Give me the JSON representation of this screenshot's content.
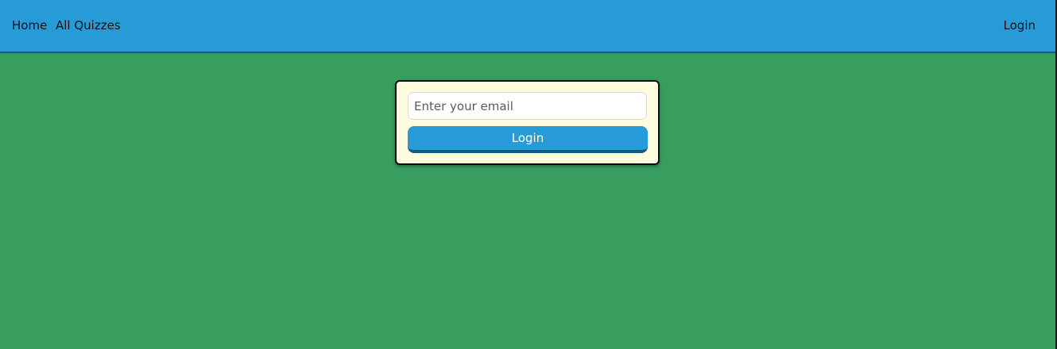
{
  "navbar": {
    "home_label": "Home",
    "quizzes_label": "All Quizzes",
    "login_label": "Login"
  },
  "login_form": {
    "email_placeholder": "Enter your email",
    "email_value": "",
    "submit_label": "Login"
  },
  "colors": {
    "navbar": "#279bd8",
    "page_background": "#389e60",
    "card_background": "#fffce0",
    "button": "#279bd8",
    "button_shadow": "#135a82"
  }
}
